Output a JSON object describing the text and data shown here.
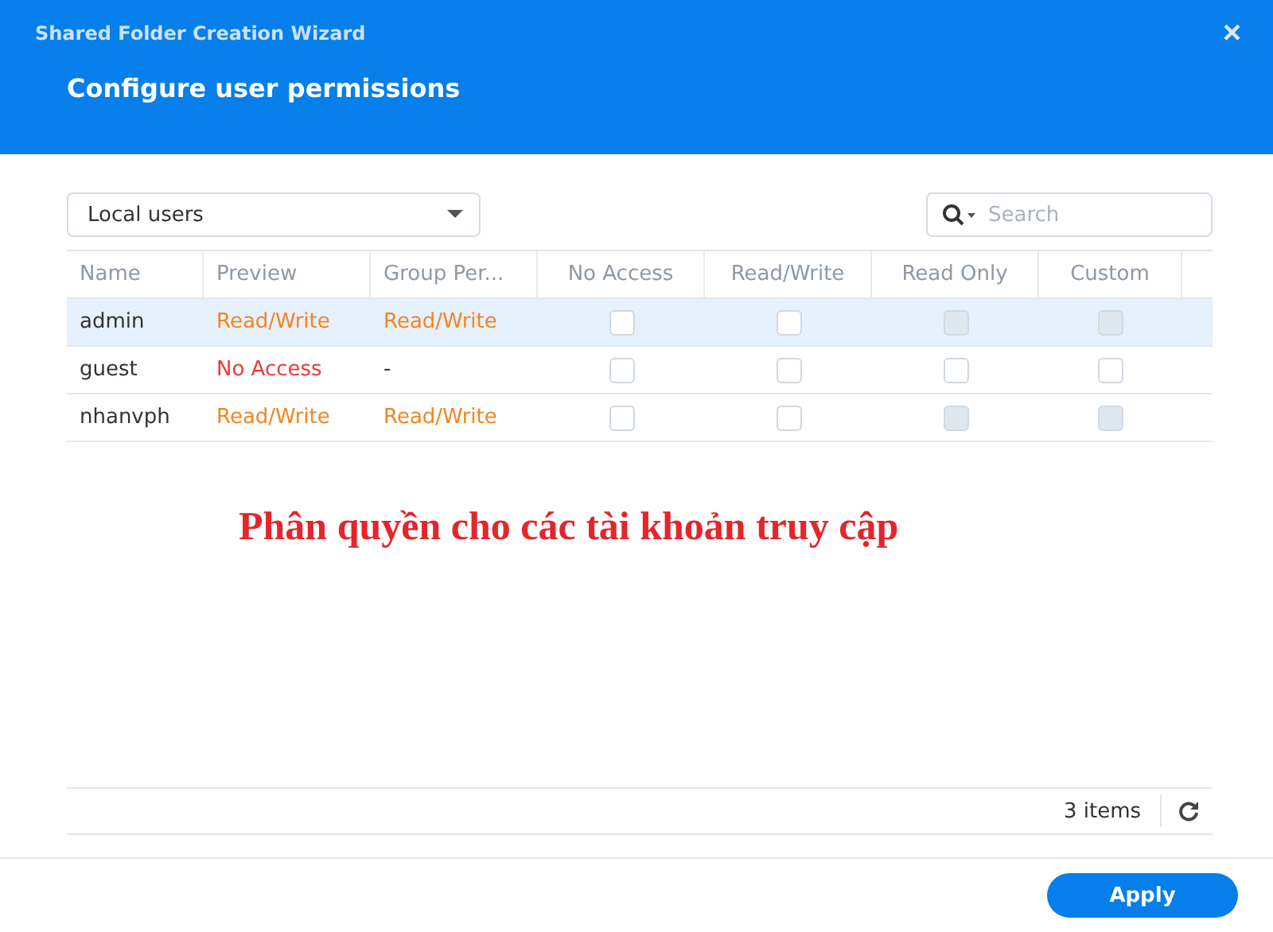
{
  "window": {
    "title": "Shared Folder Creation Wizard",
    "close": "×"
  },
  "header": {
    "title": "Configure user permissions"
  },
  "filter": {
    "value": "Local users"
  },
  "search": {
    "placeholder": "Search"
  },
  "table": {
    "columns": [
      "Name",
      "Preview",
      "Group Per...",
      "No Access",
      "Read/Write",
      "Read Only",
      "Custom"
    ],
    "rows": [
      {
        "name": "admin",
        "selected": true,
        "preview": {
          "text": "Read/Write",
          "kind": "read_write"
        },
        "group": {
          "text": "Read/Write",
          "kind": "read_write"
        },
        "boxes": [
          {
            "checked": false,
            "disabled": false
          },
          {
            "checked": false,
            "disabled": false
          },
          {
            "checked": false,
            "disabled": true
          },
          {
            "checked": false,
            "disabled": true
          }
        ]
      },
      {
        "name": "guest",
        "selected": false,
        "preview": {
          "text": "No Access",
          "kind": "no_access"
        },
        "group": {
          "text": "-",
          "kind": "none"
        },
        "boxes": [
          {
            "checked": false,
            "disabled": false
          },
          {
            "checked": false,
            "disabled": false
          },
          {
            "checked": false,
            "disabled": false
          },
          {
            "checked": false,
            "disabled": false
          }
        ]
      },
      {
        "name": "nhanvph",
        "selected": false,
        "preview": {
          "text": "Read/Write",
          "kind": "read_write"
        },
        "group": {
          "text": "Read/Write",
          "kind": "read_write"
        },
        "boxes": [
          {
            "checked": false,
            "disabled": false
          },
          {
            "checked": false,
            "disabled": false
          },
          {
            "checked": false,
            "disabled": true
          },
          {
            "checked": false,
            "disabled": true
          }
        ]
      }
    ]
  },
  "annotation": "Phân quyền cho các tài khoản truy cập",
  "footer": {
    "count": "3 items"
  },
  "buttons": [
    "Apply"
  ]
}
